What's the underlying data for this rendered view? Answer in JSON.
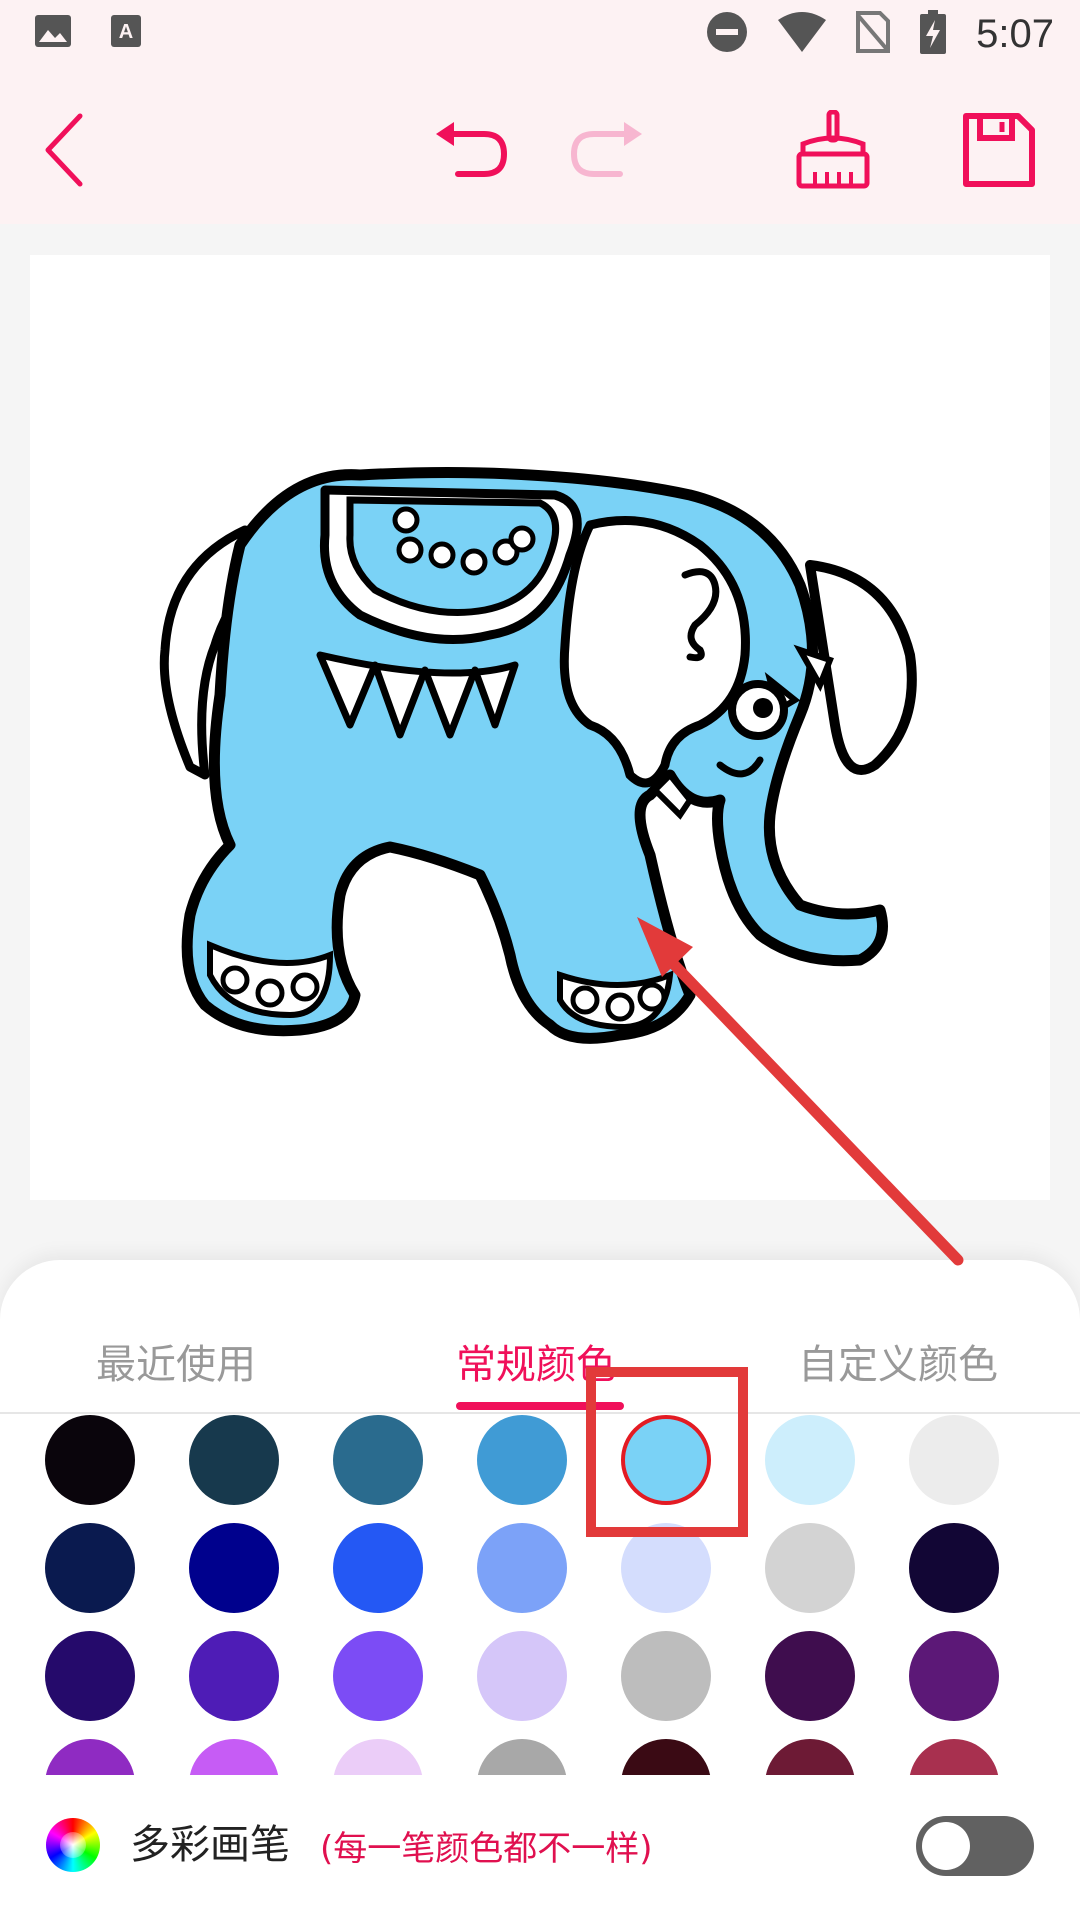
{
  "status_bar": {
    "time": "5:07",
    "left_icons": [
      "image-icon",
      "text-a-icon"
    ],
    "right_icons": [
      "do-not-disturb-icon",
      "wifi-icon",
      "no-sim-icon",
      "battery-charging-icon"
    ]
  },
  "toolbar": {
    "buttons": [
      "back-icon",
      "undo-icon",
      "redo-icon",
      "clear-brush-icon",
      "save-icon"
    ],
    "accent": "#f0105a",
    "redo_disabled_color": "#f7b6d0"
  },
  "canvas": {
    "drawing": "elephant coloring page",
    "fill_color": "#7ad2f6"
  },
  "tabs": [
    {
      "label": "最近使用",
      "active": false
    },
    {
      "label": "常规颜色",
      "active": true
    },
    {
      "label": "自定义颜色",
      "active": false
    }
  ],
  "palette": {
    "rows": [
      [
        "#0a050c",
        "#17394d",
        "#2a6b8e",
        "#409bd5",
        "#7ad2f6",
        "#cdeefc",
        "#ececec"
      ],
      [
        "#0a1a4f",
        "#00018d",
        "#2458f4",
        "#7ca2f8",
        "#d4ddfd",
        "#d3d3d3",
        "#120635"
      ],
      [
        "#250a6b",
        "#4e1cb6",
        "#7c4cf5",
        "#d5c6f9",
        "#bdbdbd",
        "#3f0d4e",
        "#5c1877"
      ],
      [
        "#8f2bc2",
        "#c65cf5",
        "#ebcdf8",
        "#a8a8a8",
        "#3a0a14",
        "#6d1a35",
        "#a8304f"
      ]
    ],
    "selected": "#7ad2f6"
  },
  "multicolor_pen": {
    "label": "多彩画笔",
    "note": "(每一笔颜色都不一样)",
    "enabled": false
  },
  "annotation": {
    "color": "#e23a3a"
  }
}
